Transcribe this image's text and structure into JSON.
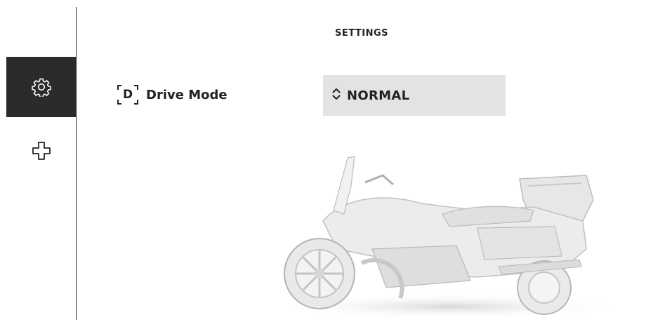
{
  "header": {
    "title": "SETTINGS"
  },
  "sidebar": {
    "items": [
      {
        "icon": "gear-icon",
        "active": true
      },
      {
        "icon": "plus-outline-icon",
        "active": false
      }
    ]
  },
  "settings": {
    "drive_mode": {
      "icon_letter": "D",
      "label": "Drive Mode",
      "value": "NORMAL"
    }
  },
  "colors": {
    "sidebar_active_bg": "#2b2b2b",
    "selector_bg": "#e3e3e3",
    "text": "#222222"
  }
}
